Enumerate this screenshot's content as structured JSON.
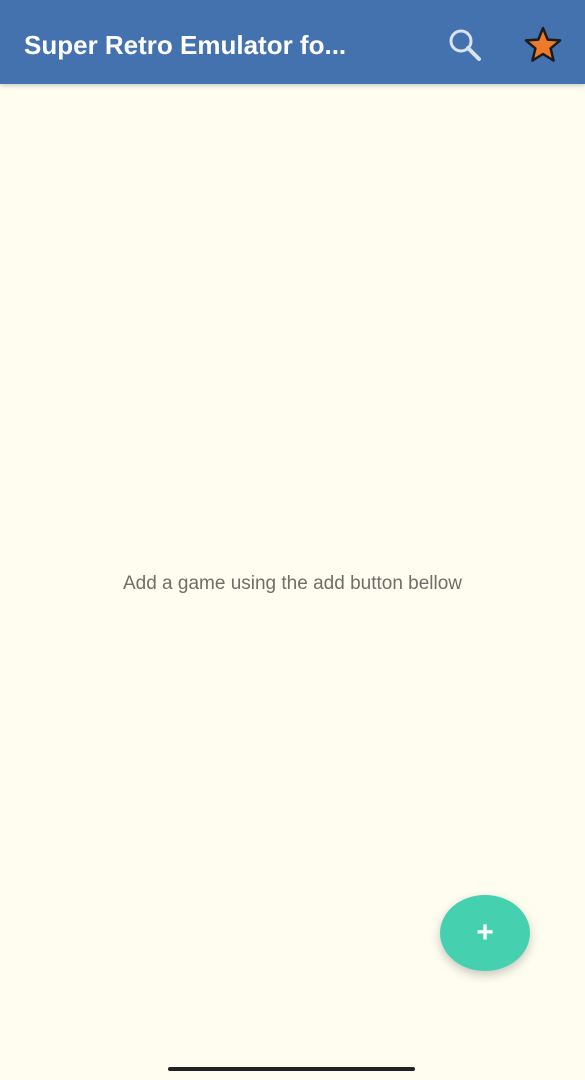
{
  "app_bar": {
    "title": "Super Retro Emulator fo...",
    "background_color": "#4472af",
    "actions": [
      {
        "name": "search",
        "icon": "search-icon"
      },
      {
        "name": "favorites",
        "icon": "star-icon",
        "color": "#f07a2b"
      }
    ]
  },
  "main": {
    "empty_message": "Add a game using the add button bellow",
    "background_color": "#fefdf0"
  },
  "fab": {
    "icon": "plus-icon",
    "label": "+",
    "color": "#45d1b0"
  }
}
